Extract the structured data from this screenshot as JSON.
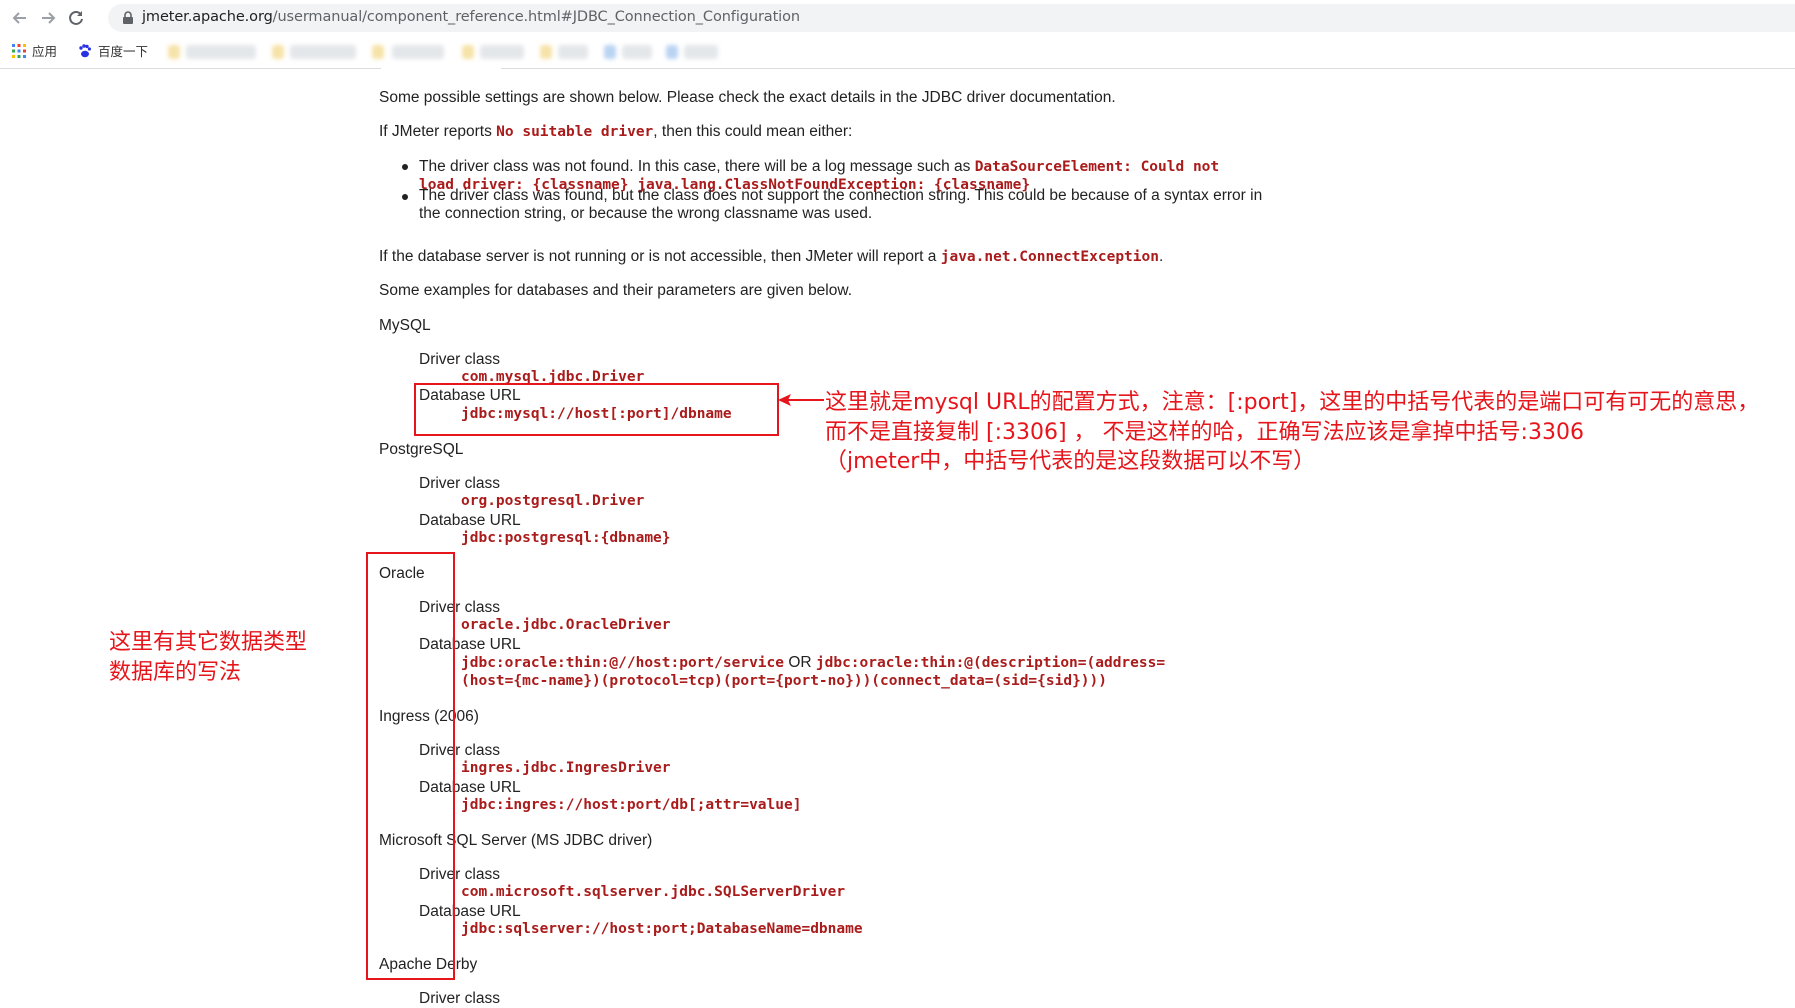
{
  "browser": {
    "url_host": "jmeter.apache.org",
    "url_path": "/usermanual/component_reference.html#JDBC_Connection_Configuration",
    "bookmarks": [
      {
        "label": "应用",
        "icon": "apps-grid-icon"
      },
      {
        "label": "百度一下",
        "icon": "baidu-paw-icon"
      }
    ]
  },
  "doc": {
    "intro": "Some possible settings are shown below. Please check the exact details in the JDBC driver documentation.",
    "no_driver_prefix": "If JMeter reports ",
    "no_driver_code": "No suitable driver",
    "no_driver_suffix": ", then this could mean either:",
    "bullet1_text": "The driver class was not found. In this case, there will be a log message such as ",
    "bullet1_code_a": "DataSourceElement: Could not",
    "bullet1_code_b": "load driver: {classname} java.lang.ClassNotFoundException: {classname}",
    "bullet2_line1": "The driver class was found, but the class does not support the connection string. This could be because of a syntax error in",
    "bullet2_line2": "the connection string, or because the wrong classname was used.",
    "not_running_prefix": "If the database server is not running or is not accessible, then JMeter will report a ",
    "not_running_code": "java.net.ConnectException",
    "not_running_suffix": ".",
    "examples_intro": "Some examples for databases and their parameters are given below.",
    "driver_class_label": "Driver class",
    "database_url_label": "Database URL",
    "or_label": "OR",
    "databases": {
      "mysql": {
        "name": "MySQL",
        "driver": "com.mysql.jdbc.Driver",
        "url": "jdbc:mysql://host[:port]/dbname"
      },
      "postgresql": {
        "name": "PostgreSQL",
        "driver": "org.postgresql.Driver",
        "url": "jdbc:postgresql:{dbname}"
      },
      "oracle": {
        "name": "Oracle",
        "driver": "oracle.jdbc.OracleDriver",
        "url_a": "jdbc:oracle:thin:@//host:port/service",
        "url_b_line1": "jdbc:oracle:thin:@(description=(address=",
        "url_b_line2": "(host={mc-name})(protocol=tcp)(port={port-no}))(connect_data=(sid={sid})))"
      },
      "ingress": {
        "name": "Ingress (2006)",
        "driver": "ingres.jdbc.IngresDriver",
        "url": "jdbc:ingres://host:port/db[;attr=value]"
      },
      "mssql": {
        "name": "Microsoft SQL Server (MS JDBC driver)",
        "driver": "com.microsoft.sqlserver.jdbc.SQLServerDriver",
        "url": "jdbc:sqlserver://host:port;DatabaseName=dbname"
      },
      "derby": {
        "name": "Apache Derby",
        "driver_label": "Driver class"
      }
    }
  },
  "annotations": {
    "mysql_note_line1": "这里就是mysql URL的配置方式，注意：[:port]，这里的中括号代表的是端口可有可无的意思，",
    "mysql_note_line2": "而不是直接复制 [:3306] ， 不是这样的哈，正确写法应该是拿掉中括号:3306",
    "mysql_note_line3": "（jmeter中，中括号代表的是这段数据可以不写）",
    "other_db_note_line1": "这里有其它数据类型",
    "other_db_note_line2": "数据库的写法",
    "color": "#e6151b"
  }
}
